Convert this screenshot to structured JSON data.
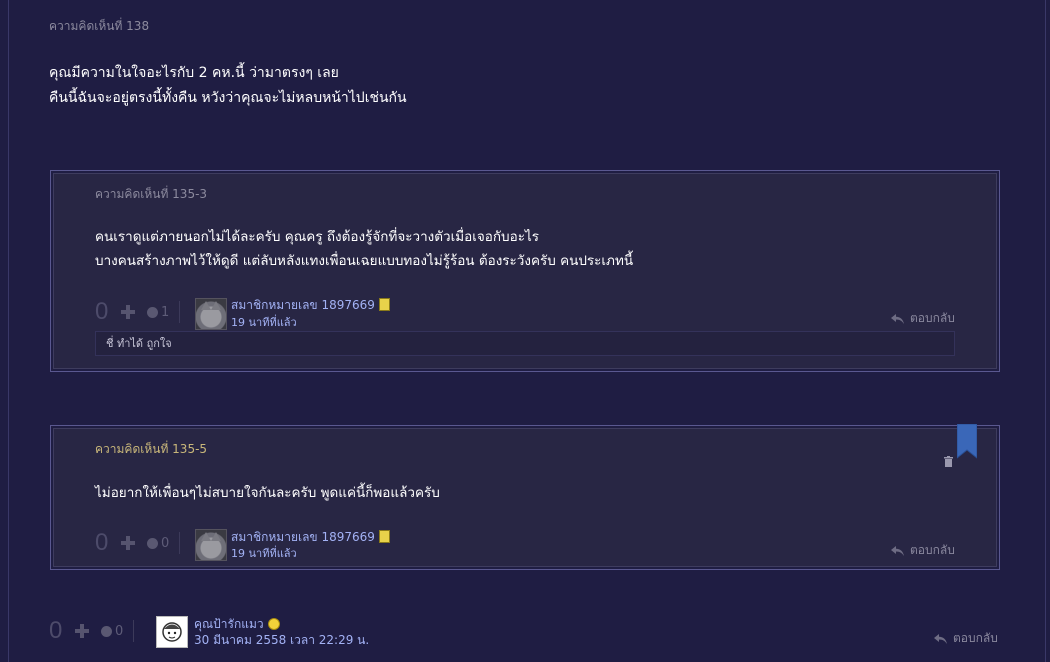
{
  "main_comment": {
    "label": "ความคิดเห็นที่ 138",
    "lines": [
      "คุณมีความในใจอะไรกับ 2 คห.นี้ ว่ามาตรงๆ เลย",
      "คืนนี้ฉันจะอยู่ตรงนี้ทั้งคืน หวังว่าคุณจะไม่หลบหน้าไปเช่นกัน"
    ],
    "vote_count": "0",
    "emotion_count": "0",
    "author": "คุณป้ารักแมว",
    "timestamp": "30 มีนาคม 2558 เวลา 22:29 น.",
    "reply_label": "ตอบกลับ"
  },
  "replies": [
    {
      "label": "ความคิดเห็นที่ 135-3",
      "lines": [
        "คนเราดูแต่ภายนอกไม่ได้ละครับ   คุณครู   ถึงต้องรู้จักที่จะวางตัวเมื่อเจอกับอะไร",
        "บางคนสร้างภาพไว้ให้ดูดี   แต่ลับหลังแทงเพื่อนเฉยแบบทองไม่รู้ร้อน    ต้องระวังครับ   คนประเภทนี้"
      ],
      "vote_count": "0",
      "emotion_count": "1",
      "author": "สมาชิกหมายเลข 1897669",
      "timestamp": "19 นาทีที่แล้ว",
      "reply_label": "ตอบกลับ",
      "reactions": "ชี่ ทำได้ ถูกใจ"
    },
    {
      "label": "ความคิดเห็นที่ 135-5",
      "lines": [
        "ไม่อยากให้เพื่อนๆไม่สบายใจกันละครับ   พูดแค่นี้ก็พอแล้วครับ"
      ],
      "vote_count": "0",
      "emotion_count": "0",
      "author": "สมาชิกหมายเลข 1897669",
      "timestamp": "19 นาทีที่แล้ว",
      "reply_label": "ตอบกลับ"
    }
  ],
  "colors": {
    "background": "#1f1d43",
    "panel": "#282644",
    "label_muted": "#8c8a9e",
    "label_highlight": "#c9b77a",
    "username": "#a3b2f5",
    "bookmark": "#3a67b8"
  }
}
